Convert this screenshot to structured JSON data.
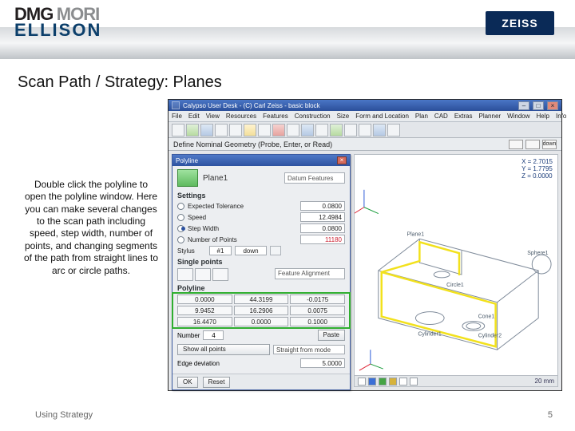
{
  "header": {
    "logo_line1_a": "DMG",
    "logo_line1_b": "MORI",
    "logo_line2": "ELLISON",
    "zeiss": "ZEISS"
  },
  "slide": {
    "title": "Scan Path / Strategy: Planes",
    "body": "Double click the polyline to open the polyline window. Here you can make several changes to the scan path including speed, step width, number of points, and changing segments of the path from straight lines to arc or circle paths.",
    "footer_left": "Using Strategy",
    "footer_right": "5"
  },
  "app": {
    "title": "Calypso User Desk - (C) Carl Zeiss - basic block",
    "menu": [
      "File",
      "Edit",
      "View",
      "Resources",
      "Features",
      "Construction",
      "Size",
      "Form and Location",
      "Plan",
      "CAD",
      "Extras",
      "Planner",
      "Window",
      "Help",
      "Info"
    ],
    "define_bar": "Define Nominal Geometry (Probe, Enter, or Read)",
    "mode_down": "down"
  },
  "dlg": {
    "title": "Polyline",
    "plane": "Plane1",
    "datum": "Datum Features",
    "section_settings": "Settings",
    "opt_tol": "Expected Tolerance",
    "opt_speed": "Speed",
    "opt_step": "Step Width",
    "opt_pts": "Number of Points",
    "val_tol": "0.0800",
    "val_speed": "12.4984",
    "val_step": "0.0800",
    "val_pts": "11180",
    "stylus_lbl": "Stylus",
    "stylus_no": "#1",
    "stylus_dir": "down",
    "section_sp": "Single points",
    "feat_align": "Feature Alignment",
    "section_poly": "Polyline",
    "grid": [
      [
        "0.0000",
        "44.3199",
        "-0.0175"
      ],
      [
        "9.9452",
        "16.2906",
        "0.0075"
      ],
      [
        "16.4470",
        "0.0000",
        "0.1000"
      ]
    ],
    "number_lbl": "Number",
    "number_val": "4",
    "paste": "Paste",
    "show_all": "Show all points",
    "straight": "Straight from mode",
    "edge_lbl": "Edge deviation",
    "edge_val": "5.0000",
    "ok": "OK",
    "reset": "Reset"
  },
  "view": {
    "x": "X = 2.7015",
    "y": "Y = 1.7795",
    "z": "Z = 0.0000",
    "labels": {
      "plane": "Plane1",
      "cyl1": "Cylinder1",
      "cyl2": "Cylinder2",
      "circ": "Circle1",
      "cone": "Cone1",
      "sph": "Sphere1"
    },
    "scale": "20 mm"
  }
}
